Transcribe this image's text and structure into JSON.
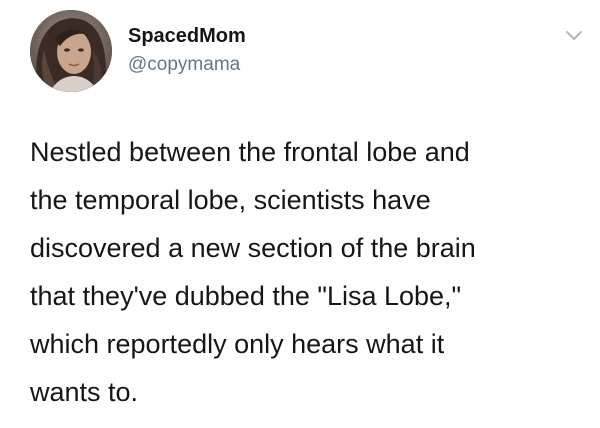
{
  "user": {
    "display_name": "SpacedMom",
    "handle": "@copymama",
    "avatar_icon": "user-avatar-photo"
  },
  "menu": {
    "icon": "chevron-down-icon",
    "color": "#aab8c2"
  },
  "tweet": {
    "lines": [
      "Nestled between the frontal lobe and",
      "the temporal lobe, scientists have",
      "discovered a new section of the brain",
      "that they've dubbed the \"Lisa Lobe,\"",
      "which reportedly only hears what it",
      "wants to."
    ]
  },
  "colors": {
    "text": "#14171a",
    "secondary": "#657786",
    "background": "#ffffff"
  }
}
